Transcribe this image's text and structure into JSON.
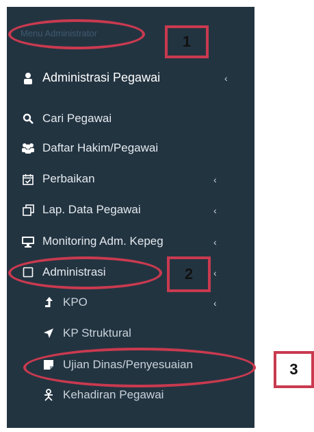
{
  "sidebar": {
    "header": "Menu Administrator",
    "items": [
      {
        "label": "Administrasi Pegawai",
        "icon": "user-icon",
        "chevron": "‹"
      },
      {
        "label": "Cari Pegawai",
        "icon": "search-icon"
      },
      {
        "label": "Daftar Hakim/Pegawai",
        "icon": "users-icon"
      },
      {
        "label": "Perbaikan",
        "icon": "calendar-check-icon",
        "chevron": "‹"
      },
      {
        "label": "Lap. Data Pegawai",
        "icon": "copy-icon",
        "chevron": "‹"
      },
      {
        "label": "Monitoring Adm. Kepeg",
        "icon": "monitor-icon",
        "chevron": "‹"
      },
      {
        "label": "Administrasi",
        "icon": "square-icon",
        "chevron": "‹"
      },
      {
        "label": "KPO",
        "icon": "level-up-icon",
        "chevron": "‹"
      },
      {
        "label": "KP Struktural",
        "icon": "location-arrow-icon"
      },
      {
        "label": "Ujian Dinas/Penyesuaian",
        "icon": "sticky-note-icon"
      },
      {
        "label": "Kehadiran Pegawai",
        "icon": "person-icon"
      }
    ]
  },
  "annotations": {
    "badge1": "1",
    "badge2": "2",
    "badge3": "3",
    "highlight_color": "#c93a4f"
  },
  "colors": {
    "sidebar_bg": "#233441",
    "header_text": "#3f5a72"
  }
}
